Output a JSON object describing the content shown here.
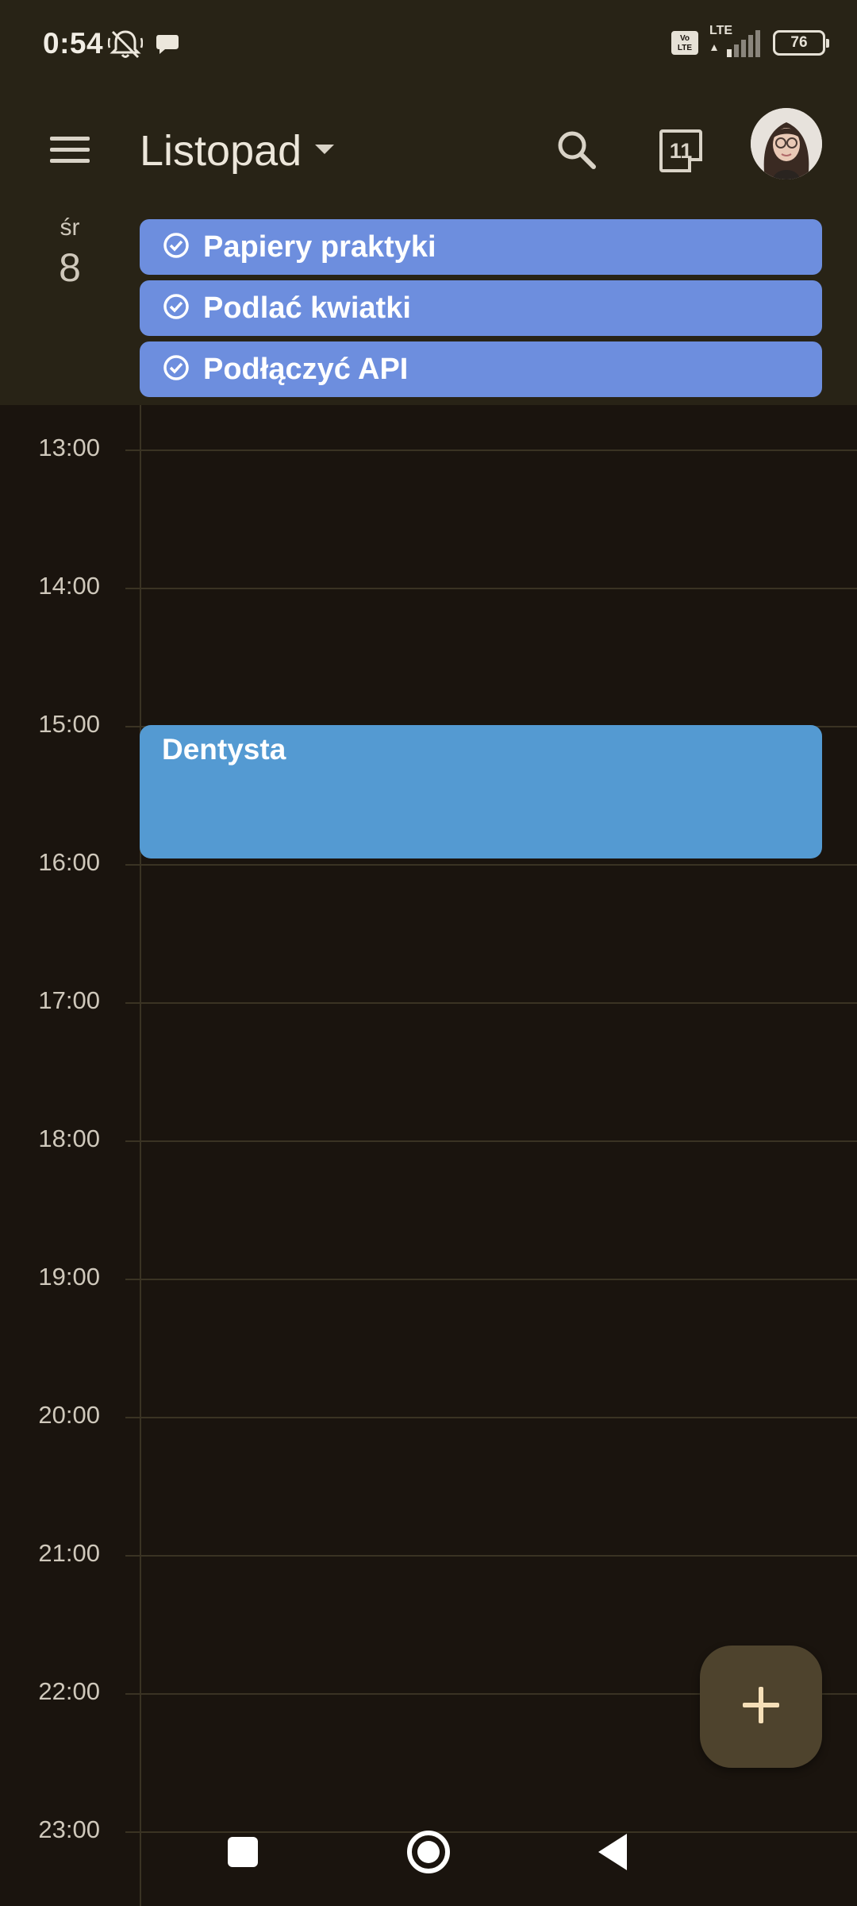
{
  "status_bar": {
    "time": "0:54",
    "network": "LTE",
    "volte": "Vo LTE",
    "battery": "76"
  },
  "app_bar": {
    "month": "Listopad"
  },
  "today_icon": {
    "day": "11"
  },
  "day": {
    "weekday": "śr",
    "number": "8"
  },
  "tasks": [
    {
      "label": "Papiery praktyki"
    },
    {
      "label": "Podlać kwiatki"
    },
    {
      "label": "Podłączyć API"
    }
  ],
  "hours": [
    "13:00",
    "14:00",
    "15:00",
    "16:00",
    "17:00",
    "18:00",
    "19:00",
    "20:00",
    "21:00",
    "22:00",
    "23:00"
  ],
  "events": [
    {
      "title": "Dentysta"
    }
  ],
  "colors": {
    "task_chip": "#6d8ede",
    "event": "#549ad2",
    "fab": "#4e432d",
    "background": "#1a140e",
    "header": "#282316"
  }
}
